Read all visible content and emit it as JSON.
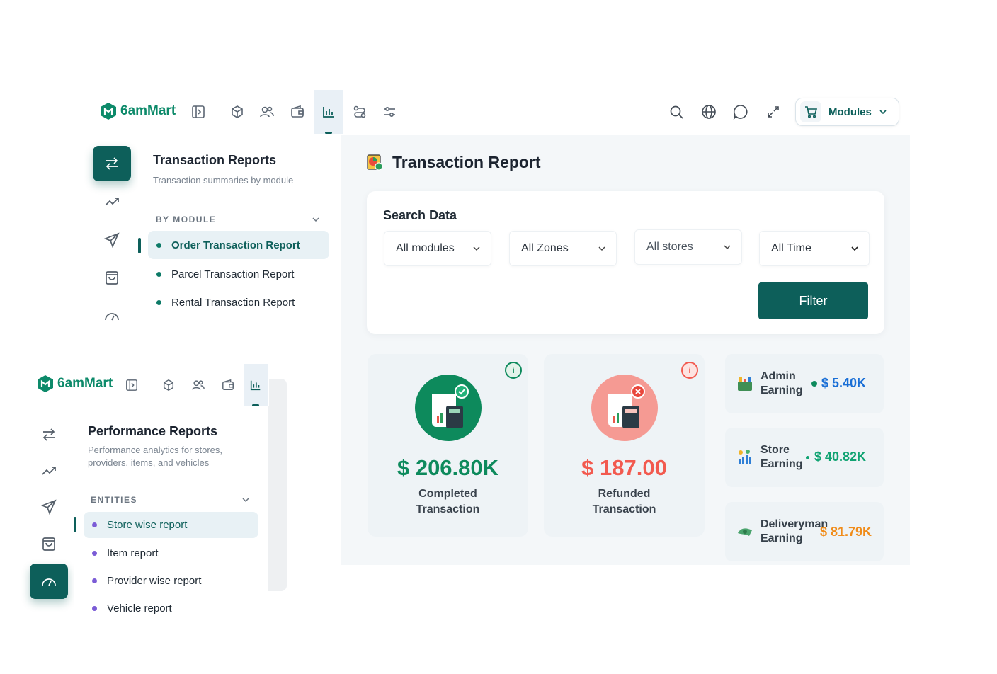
{
  "main_window": {
    "brand": "6amMart",
    "header": {
      "icons": [
        "panel-toggle-icon",
        "box-icon",
        "users-icon",
        "wallet-icon",
        "chart-bar-icon",
        "route-icon",
        "sliders-icon"
      ],
      "active_icon": "chart-bar-icon",
      "right_icons": [
        "search-icon",
        "globe-icon",
        "chat-icon",
        "expand-icon"
      ],
      "modules_label": "Modules"
    },
    "rail": {
      "items": [
        "swap-icon",
        "trending-up-icon",
        "send-icon",
        "bag-icon",
        "gauge-icon"
      ],
      "active": "swap-icon"
    },
    "submenu": {
      "title": "Transaction Reports",
      "description": "Transaction summaries by module",
      "section_label": "BY MODULE",
      "items": [
        {
          "label": "Order Transaction Report",
          "active": true
        },
        {
          "label": "Parcel Transaction Report",
          "active": false
        },
        {
          "label": "Rental Transaction Report",
          "active": false
        }
      ]
    },
    "content": {
      "title": "Transaction Report",
      "search": {
        "title": "Search Data",
        "selects": [
          "All modules",
          "All Zones",
          "All stores",
          "All Time"
        ],
        "filter_label": "Filter"
      },
      "stats": [
        {
          "value": "$ 206.80K",
          "label_line1": "Completed",
          "label_line2": "Transaction",
          "color": "#0d8a5c"
        },
        {
          "value": "$ 187.00",
          "label_line1": "Refunded",
          "label_line2": "Transaction",
          "color": "#f25a4f"
        }
      ],
      "earnings": [
        {
          "label_line1": "Admin",
          "label_line2": "Earning",
          "value": "$ 5.40K",
          "color": "#1a6fd6"
        },
        {
          "label_line1": "Store",
          "label_line2": "Earning",
          "value": "$ 40.82K",
          "color": "#10a372"
        },
        {
          "label_line1": "Deliveryman",
          "label_line2": "Earning",
          "value": "$ 81.79K",
          "color": "#f08c1a"
        }
      ]
    }
  },
  "overlay_window": {
    "brand": "6amMart",
    "submenu": {
      "title": "Performance Reports",
      "description_line1": "Performance analytics for stores,",
      "description_line2": "providers, items, and vehicles",
      "section_label": "ENTITIES",
      "items": [
        {
          "label": "Store wise report",
          "active": true
        },
        {
          "label": "Item report",
          "active": false
        },
        {
          "label": "Provider wise report",
          "active": false
        },
        {
          "label": "Vehicle report",
          "active": false
        }
      ]
    },
    "rail": {
      "items": [
        "swap-icon",
        "trending-up-icon",
        "send-icon",
        "bag-icon",
        "gauge-icon"
      ],
      "active": "gauge-icon"
    }
  },
  "colors": {
    "primary": "#0d5f5a",
    "brand_green": "#0d8a6a",
    "content_bg": "#f4f7f9"
  }
}
